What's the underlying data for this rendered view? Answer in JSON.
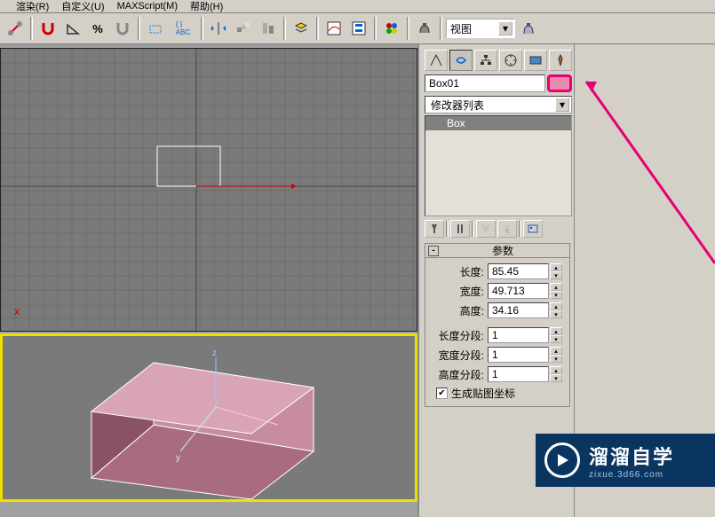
{
  "menu": {
    "items": [
      "  ",
      "渲染(R)",
      "自定义(U)",
      "MAXScript(M)",
      "帮助(H)"
    ]
  },
  "toolbar": {
    "dropdown": "视图"
  },
  "panel": {
    "object_name": "Box01",
    "modifier_list_label": "修改器列表",
    "stack_item": "Box"
  },
  "rollout": {
    "title": "参数",
    "length_label": "长度:",
    "length_value": "85.45",
    "width_label": "宽度:",
    "width_value": "49.713",
    "height_label": "高度:",
    "height_value": "34.16",
    "lseg_label": "长度分段:",
    "lseg_value": "1",
    "wseg_label": "宽度分段:",
    "wseg_value": "1",
    "hseg_label": "高度分段:",
    "hseg_value": "1",
    "gen_uv": "生成贴图坐标"
  },
  "watermark": {
    "title": "溜溜自学",
    "url": "zixue.3d66.com"
  }
}
